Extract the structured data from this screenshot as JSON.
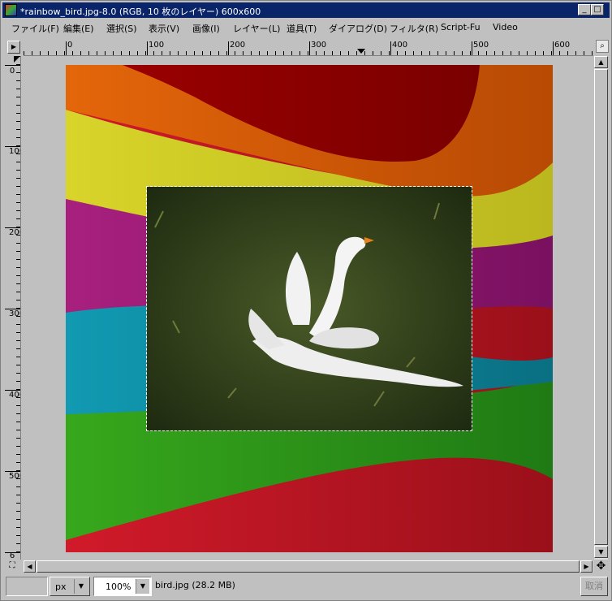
{
  "window": {
    "title": "*rainbow_bird.jpg-8.0 (RGB, 10 枚のレイヤー) 600x600",
    "minimize_glyph": "_",
    "maximize_glyph": "□",
    "close_glyph": "×"
  },
  "menu": [
    "ファイル(F)",
    "編集(E)",
    "選択(S)",
    "表示(V)",
    "画像(I)",
    "レイヤー(L)",
    "道具(T)",
    "ダイアログ(D)",
    "フィルタ(R)",
    "Script-Fu",
    "Video"
  ],
  "ruler": {
    "h_labels": [
      "0",
      "100",
      "200",
      "300",
      "400",
      "500",
      "600"
    ],
    "v_labels": [
      "0",
      "100",
      "200",
      "300",
      "400",
      "500",
      "6"
    ]
  },
  "status": {
    "unit": "px",
    "zoom": "100%",
    "file_info": "bird.jpg (28.2 MB)",
    "cancel_label": "取消"
  },
  "icons": {
    "menu_arrow": "▶",
    "zoom": "⌕",
    "scroll_up": "▲",
    "scroll_down": "▼",
    "scroll_left": "◀",
    "scroll_right": "▶",
    "navigate": "✥",
    "quickmask": "⛶",
    "combo_down": "▼"
  },
  "colors": {
    "title_bar": "#0a246a",
    "orange": "#e0640a",
    "dark_red": "#8a0000",
    "yellow": "#d4d228",
    "magenta": "#a01a78",
    "cyan": "#0e8aa0",
    "green": "#2a9a1a",
    "red": "#c4182a"
  }
}
